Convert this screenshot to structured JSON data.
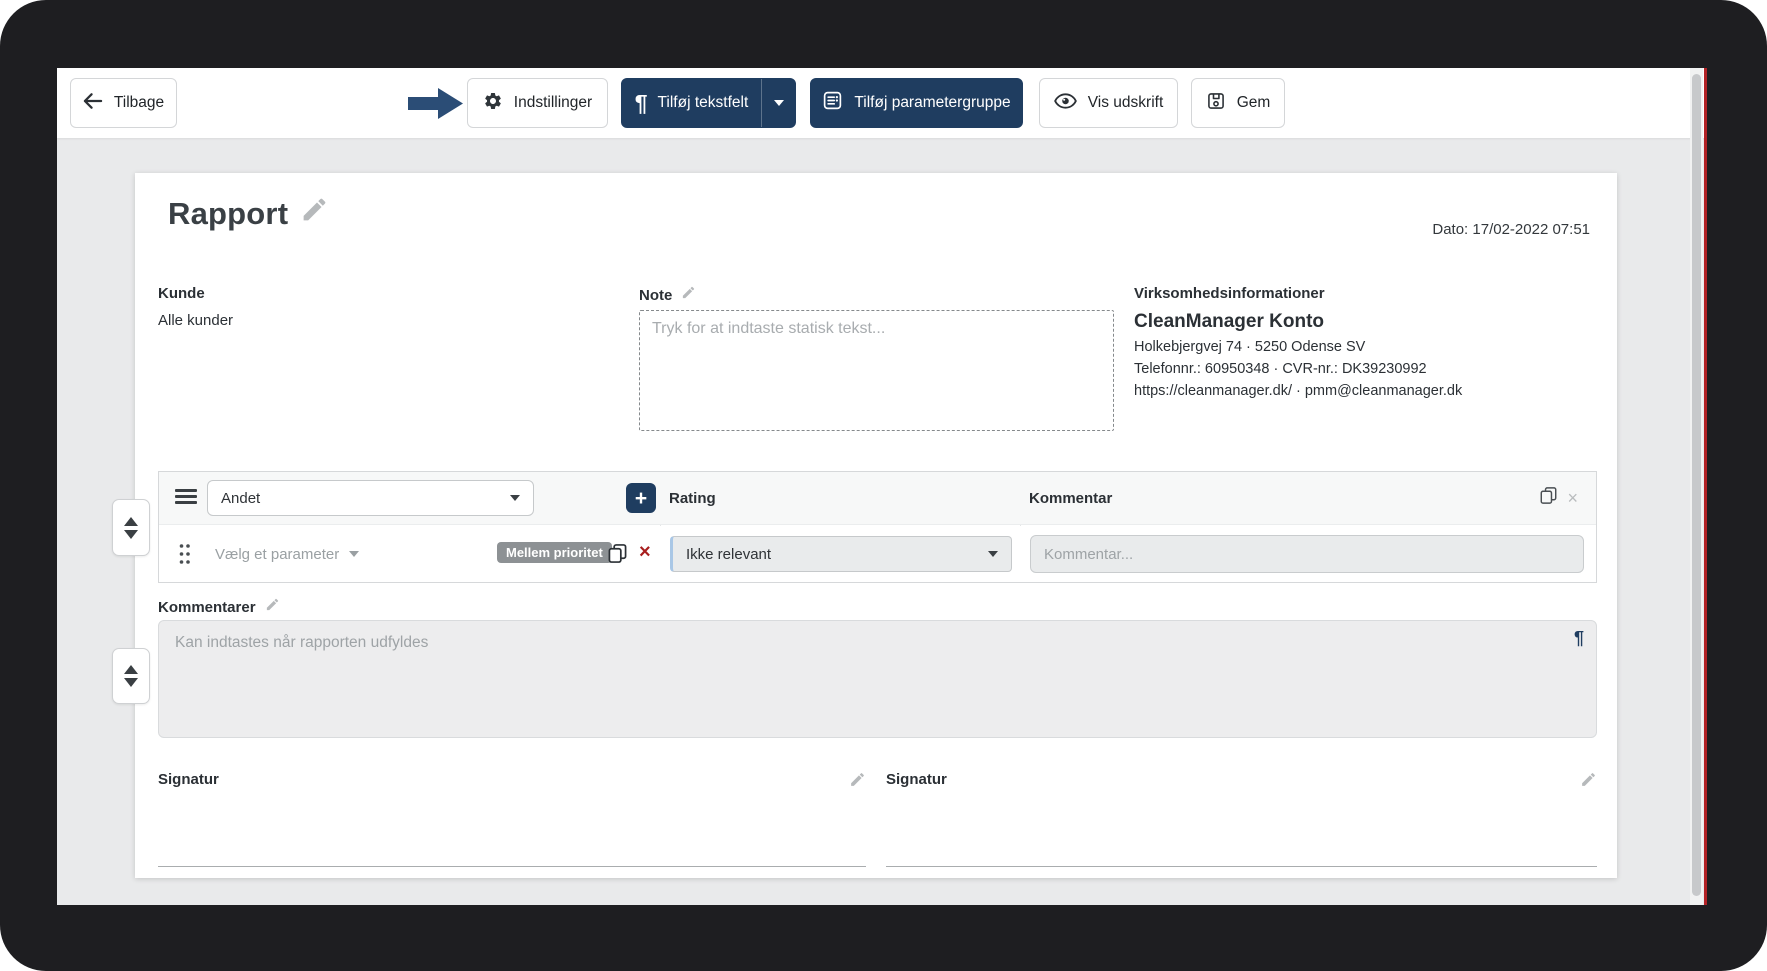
{
  "colors": {
    "navy": "#1f3d60",
    "pointer_arrow_navy": "#2b4d76",
    "badge_gray": "#8d9194",
    "danger_red": "#a81e1e",
    "frame_black": "#1e1e21",
    "content_gray": "#e9eaeb",
    "right_edge_line_red": "#b22226"
  },
  "glyphs": {
    "plus": "+",
    "close": "×",
    "remove": "×",
    "pilcrow": "¶"
  },
  "toolbar": {
    "back_label": "Tilbage",
    "settings_label": "Indstillinger",
    "add_textfield_label": "Tilføj tekstfelt",
    "add_parametergroup_label": "Tilføj parametergruppe",
    "preview_label": "Vis udskrift",
    "save_label": "Gem"
  },
  "report": {
    "title": "Rapport",
    "date": "Dato: 17/02-2022 07:51",
    "customer": {
      "label": "Kunde",
      "value": "Alle kunder"
    },
    "note": {
      "label": "Note",
      "placeholder": "Tryk for at indtaste statisk tekst..."
    },
    "company": {
      "heading": "Virksomhedsinformationer",
      "name": "CleanManager Konto",
      "address_line": "Holkebjergvej 74 · 5250 Odense SV",
      "phone_cvr_line": "Telefonnr.: 60950348 · CVR-nr.: DK39230992",
      "web_mail_line": "https://cleanmanager.dk/ · pmm@cleanmanager.dk"
    },
    "parameter_group": {
      "category_value": "Andet",
      "rating_header": "Rating",
      "comment_header": "Kommentar",
      "row": {
        "parameter_placeholder": "Vælg et parameter",
        "priority_badge": "Mellem prioritet",
        "rating_value": "Ikke relevant",
        "comment_placeholder": "Kommentar..."
      }
    },
    "comments": {
      "label": "Kommentarer",
      "placeholder": "Kan indtastes når rapporten udfyldes"
    },
    "signatures": [
      {
        "label": "Signatur"
      },
      {
        "label": "Signatur"
      }
    ]
  }
}
